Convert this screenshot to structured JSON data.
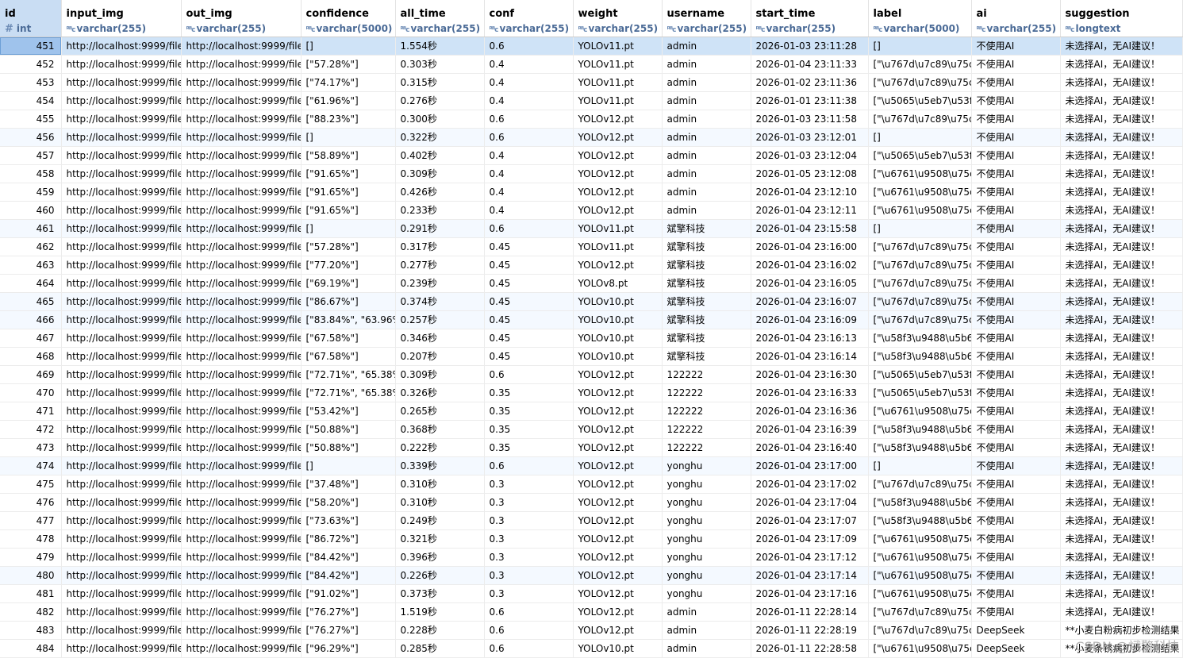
{
  "columns": [
    {
      "name": "id",
      "type": "int",
      "type_icon": "#"
    },
    {
      "name": "input_img",
      "type": "varchar(255)",
      "type_icon": "ᴿᴮc"
    },
    {
      "name": "out_img",
      "type": "varchar(255)",
      "type_icon": "ᴿᴮc"
    },
    {
      "name": "confidence",
      "type": "varchar(5000)",
      "type_icon": "ᴿᴮc"
    },
    {
      "name": "all_time",
      "type": "varchar(255)",
      "type_icon": "ᴿᴮc"
    },
    {
      "name": "conf",
      "type": "varchar(255)",
      "type_icon": "ᴿᴮc"
    },
    {
      "name": "weight",
      "type": "varchar(255)",
      "type_icon": "ᴿᴮc"
    },
    {
      "name": "username",
      "type": "varchar(255)",
      "type_icon": "ᴿᴮc"
    },
    {
      "name": "start_time",
      "type": "varchar(255)",
      "type_icon": "ᴿᴮc"
    },
    {
      "name": "label",
      "type": "varchar(5000)",
      "type_icon": "ᴿᴮc"
    },
    {
      "name": "ai",
      "type": "varchar(255)",
      "type_icon": "ᴿᴮc"
    },
    {
      "name": "suggestion",
      "type": "longtext",
      "type_icon": "ᴿᴮc"
    }
  ],
  "rows": [
    [
      "451",
      "http://localhost:9999/file",
      "http://localhost:9999/file",
      "[]",
      "1.554秒",
      "0.6",
      "YOLOv11.pt",
      "admin",
      "2026-01-03 23:11:28",
      "[]",
      "不使用AI",
      "未选择AI，无AI建议！"
    ],
    [
      "452",
      "http://localhost:9999/file",
      "http://localhost:9999/file",
      "[\"57.28%\"]",
      "0.303秒",
      "0.4",
      "YOLOv11.pt",
      "admin",
      "2026-01-04 23:11:33",
      "[\"\\u767d\\u7c89\\u75c",
      "不使用AI",
      "未选择AI，无AI建议！"
    ],
    [
      "453",
      "http://localhost:9999/file",
      "http://localhost:9999/file",
      "[\"74.17%\"]",
      "0.315秒",
      "0.4",
      "YOLOv11.pt",
      "admin",
      "2026-01-02 23:11:36",
      "[\"\\u767d\\u7c89\\u75c",
      "不使用AI",
      "未选择AI，无AI建议！"
    ],
    [
      "454",
      "http://localhost:9999/file",
      "http://localhost:9999/file",
      "[\"61.96%\"]",
      "0.276秒",
      "0.4",
      "YOLOv11.pt",
      "admin",
      "2026-01-01 23:11:38",
      "[\"\\u5065\\u5eb7\\u53f",
      "不使用AI",
      "未选择AI，无AI建议！"
    ],
    [
      "455",
      "http://localhost:9999/file",
      "http://localhost:9999/file",
      "[\"88.23%\"]",
      "0.300秒",
      "0.6",
      "YOLOv12.pt",
      "admin",
      "2026-01-03 23:11:58",
      "[\"\\u767d\\u7c89\\u75c",
      "不使用AI",
      "未选择AI，无AI建议！"
    ],
    [
      "456",
      "http://localhost:9999/file",
      "http://localhost:9999/file",
      "[]",
      "0.322秒",
      "0.6",
      "YOLOv12.pt",
      "admin",
      "2026-01-03 23:12:01",
      "[]",
      "不使用AI",
      "未选择AI，无AI建议！"
    ],
    [
      "457",
      "http://localhost:9999/file",
      "http://localhost:9999/file",
      "[\"58.89%\"]",
      "0.402秒",
      "0.4",
      "YOLOv12.pt",
      "admin",
      "2026-01-03 23:12:04",
      "[\"\\u5065\\u5eb7\\u53f",
      "不使用AI",
      "未选择AI，无AI建议！"
    ],
    [
      "458",
      "http://localhost:9999/file",
      "http://localhost:9999/file",
      "[\"91.65%\"]",
      "0.309秒",
      "0.4",
      "YOLOv12.pt",
      "admin",
      "2026-01-05 23:12:08",
      "[\"\\u6761\\u9508\\u75c",
      "不使用AI",
      "未选择AI，无AI建议！"
    ],
    [
      "459",
      "http://localhost:9999/file",
      "http://localhost:9999/file",
      "[\"91.65%\"]",
      "0.426秒",
      "0.4",
      "YOLOv12.pt",
      "admin",
      "2026-01-04 23:12:10",
      "[\"\\u6761\\u9508\\u75c",
      "不使用AI",
      "未选择AI，无AI建议！"
    ],
    [
      "460",
      "http://localhost:9999/file",
      "http://localhost:9999/file",
      "[\"91.65%\"]",
      "0.233秒",
      "0.4",
      "YOLOv12.pt",
      "admin",
      "2026-01-04 23:12:11",
      "[\"\\u6761\\u9508\\u75c",
      "不使用AI",
      "未选择AI，无AI建议！"
    ],
    [
      "461",
      "http://localhost:9999/file",
      "http://localhost:9999/file",
      "[]",
      "0.291秒",
      "0.6",
      "YOLOv11.pt",
      "斌擎科技",
      "2026-01-04 23:15:58",
      "[]",
      "不使用AI",
      "未选择AI，无AI建议！"
    ],
    [
      "462",
      "http://localhost:9999/file",
      "http://localhost:9999/file",
      "[\"57.28%\"]",
      "0.317秒",
      "0.45",
      "YOLOv11.pt",
      "斌擎科技",
      "2026-01-04 23:16:00",
      "[\"\\u767d\\u7c89\\u75c",
      "不使用AI",
      "未选择AI，无AI建议！"
    ],
    [
      "463",
      "http://localhost:9999/file",
      "http://localhost:9999/file",
      "[\"77.20%\"]",
      "0.277秒",
      "0.45",
      "YOLOv12.pt",
      "斌擎科技",
      "2026-01-04 23:16:02",
      "[\"\\u767d\\u7c89\\u75c",
      "不使用AI",
      "未选择AI，无AI建议！"
    ],
    [
      "464",
      "http://localhost:9999/file",
      "http://localhost:9999/file",
      "[\"69.19%\"]",
      "0.239秒",
      "0.45",
      "YOLOv8.pt",
      "斌擎科技",
      "2026-01-04 23:16:05",
      "[\"\\u767d\\u7c89\\u75c",
      "不使用AI",
      "未选择AI，无AI建议！"
    ],
    [
      "465",
      "http://localhost:9999/file",
      "http://localhost:9999/file",
      "[\"86.67%\"]",
      "0.374秒",
      "0.45",
      "YOLOv10.pt",
      "斌擎科技",
      "2026-01-04 23:16:07",
      "[\"\\u767d\\u7c89\\u75c",
      "不使用AI",
      "未选择AI，无AI建议！"
    ],
    [
      "466",
      "http://localhost:9999/file",
      "http://localhost:9999/file",
      "[\"83.84%\", \"63.96%",
      "0.257秒",
      "0.45",
      "YOLOv10.pt",
      "斌擎科技",
      "2026-01-04 23:16:09",
      "[\"\\u767d\\u7c89\\u75c",
      "不使用AI",
      "未选择AI，无AI建议！"
    ],
    [
      "467",
      "http://localhost:9999/file",
      "http://localhost:9999/file",
      "[\"67.58%\"]",
      "0.346秒",
      "0.45",
      "YOLOv10.pt",
      "斌擎科技",
      "2026-01-04 23:16:13",
      "[\"\\u58f3\\u9488\\u5b6",
      "不使用AI",
      "未选择AI，无AI建议！"
    ],
    [
      "468",
      "http://localhost:9999/file",
      "http://localhost:9999/file",
      "[\"67.58%\"]",
      "0.207秒",
      "0.45",
      "YOLOv10.pt",
      "斌擎科技",
      "2026-01-04 23:16:14",
      "[\"\\u58f3\\u9488\\u5b6",
      "不使用AI",
      "未选择AI，无AI建议！"
    ],
    [
      "469",
      "http://localhost:9999/file",
      "http://localhost:9999/file",
      "[\"72.71%\", \"65.38%",
      "0.309秒",
      "0.6",
      "YOLOv12.pt",
      "122222",
      "2026-01-04 23:16:30",
      "[\"\\u5065\\u5eb7\\u53f",
      "不使用AI",
      "未选择AI，无AI建议！"
    ],
    [
      "470",
      "http://localhost:9999/file",
      "http://localhost:9999/file",
      "[\"72.71%\", \"65.38%",
      "0.326秒",
      "0.35",
      "YOLOv12.pt",
      "122222",
      "2026-01-04 23:16:33",
      "[\"\\u5065\\u5eb7\\u53f",
      "不使用AI",
      "未选择AI，无AI建议！"
    ],
    [
      "471",
      "http://localhost:9999/file",
      "http://localhost:9999/file",
      "[\"53.42%\"]",
      "0.265秒",
      "0.35",
      "YOLOv12.pt",
      "122222",
      "2026-01-04 23:16:36",
      "[\"\\u6761\\u9508\\u75c",
      "不使用AI",
      "未选择AI，无AI建议！"
    ],
    [
      "472",
      "http://localhost:9999/file",
      "http://localhost:9999/file",
      "[\"50.88%\"]",
      "0.368秒",
      "0.35",
      "YOLOv12.pt",
      "122222",
      "2026-01-04 23:16:39",
      "[\"\\u58f3\\u9488\\u5b6",
      "不使用AI",
      "未选择AI，无AI建议！"
    ],
    [
      "473",
      "http://localhost:9999/file",
      "http://localhost:9999/file",
      "[\"50.88%\"]",
      "0.222秒",
      "0.35",
      "YOLOv12.pt",
      "122222",
      "2026-01-04 23:16:40",
      "[\"\\u58f3\\u9488\\u5b6",
      "不使用AI",
      "未选择AI，无AI建议！"
    ],
    [
      "474",
      "http://localhost:9999/file",
      "http://localhost:9999/file",
      "[]",
      "0.339秒",
      "0.6",
      "YOLOv12.pt",
      "yonghu",
      "2026-01-04 23:17:00",
      "[]",
      "不使用AI",
      "未选择AI，无AI建议！"
    ],
    [
      "475",
      "http://localhost:9999/file",
      "http://localhost:9999/file",
      "[\"37.48%\"]",
      "0.310秒",
      "0.3",
      "YOLOv12.pt",
      "yonghu",
      "2026-01-04 23:17:02",
      "[\"\\u767d\\u7c89\\u75c",
      "不使用AI",
      "未选择AI，无AI建议！"
    ],
    [
      "476",
      "http://localhost:9999/file",
      "http://localhost:9999/file",
      "[\"58.20%\"]",
      "0.310秒",
      "0.3",
      "YOLOv12.pt",
      "yonghu",
      "2026-01-04 23:17:04",
      "[\"\\u58f3\\u9488\\u5b6",
      "不使用AI",
      "未选择AI，无AI建议！"
    ],
    [
      "477",
      "http://localhost:9999/file",
      "http://localhost:9999/file",
      "[\"73.63%\"]",
      "0.249秒",
      "0.3",
      "YOLOv12.pt",
      "yonghu",
      "2026-01-04 23:17:07",
      "[\"\\u58f3\\u9488\\u5b6",
      "不使用AI",
      "未选择AI，无AI建议！"
    ],
    [
      "478",
      "http://localhost:9999/file",
      "http://localhost:9999/file",
      "[\"86.72%\"]",
      "0.321秒",
      "0.3",
      "YOLOv12.pt",
      "yonghu",
      "2026-01-04 23:17:09",
      "[\"\\u6761\\u9508\\u75c",
      "不使用AI",
      "未选择AI，无AI建议！"
    ],
    [
      "479",
      "http://localhost:9999/file",
      "http://localhost:9999/file",
      "[\"84.42%\"]",
      "0.396秒",
      "0.3",
      "YOLOv12.pt",
      "yonghu",
      "2026-01-04 23:17:12",
      "[\"\\u6761\\u9508\\u75c",
      "不使用AI",
      "未选择AI，无AI建议！"
    ],
    [
      "480",
      "http://localhost:9999/file",
      "http://localhost:9999/file",
      "[\"84.42%\"]",
      "0.226秒",
      "0.3",
      "YOLOv12.pt",
      "yonghu",
      "2026-01-04 23:17:14",
      "[\"\\u6761\\u9508\\u75c",
      "不使用AI",
      "未选择AI，无AI建议！"
    ],
    [
      "481",
      "http://localhost:9999/file",
      "http://localhost:9999/file",
      "[\"91.02%\"]",
      "0.373秒",
      "0.3",
      "YOLOv12.pt",
      "yonghu",
      "2026-01-04 23:17:16",
      "[\"\\u6761\\u9508\\u75c",
      "不使用AI",
      "未选择AI，无AI建议！"
    ],
    [
      "482",
      "http://localhost:9999/file",
      "http://localhost:9999/file",
      "[\"76.27%\"]",
      "1.519秒",
      "0.6",
      "YOLOv12.pt",
      "admin",
      "2026-01-11 22:28:14",
      "[\"\\u767d\\u7c89\\u75c",
      "不使用AI",
      "未选择AI，无AI建议！"
    ],
    [
      "483",
      "http://localhost:9999/file",
      "http://localhost:9999/file",
      "[\"76.27%\"]",
      "0.228秒",
      "0.6",
      "YOLOv12.pt",
      "admin",
      "2026-01-11 22:28:19",
      "[\"\\u767d\\u7c89\\u75c",
      "DeepSeek",
      "**小麦白粉病初步检测结果"
    ],
    [
      "484",
      "http://localhost:9999/file",
      "http://localhost:9999/file",
      "[\"96.29%\"]",
      "0.285秒",
      "0.6",
      "YOLOv10.pt",
      "admin",
      "2026-01-11 22:28:58",
      "[\"\\u6761\\u9508\\u75c",
      "DeepSeek",
      "**小麦条锈病初步检测结果"
    ]
  ],
  "selected_row_index": 0,
  "alt_row_indices": [
    5,
    10,
    14,
    15,
    23,
    29
  ],
  "watermark": "CSDN @斌擎科技",
  "colors": {
    "selected_row": "#cfe3f7",
    "header_id_bg": "#c9ddf3",
    "type_text": "#4a6a96",
    "alt_row": "#f4f9ff"
  }
}
